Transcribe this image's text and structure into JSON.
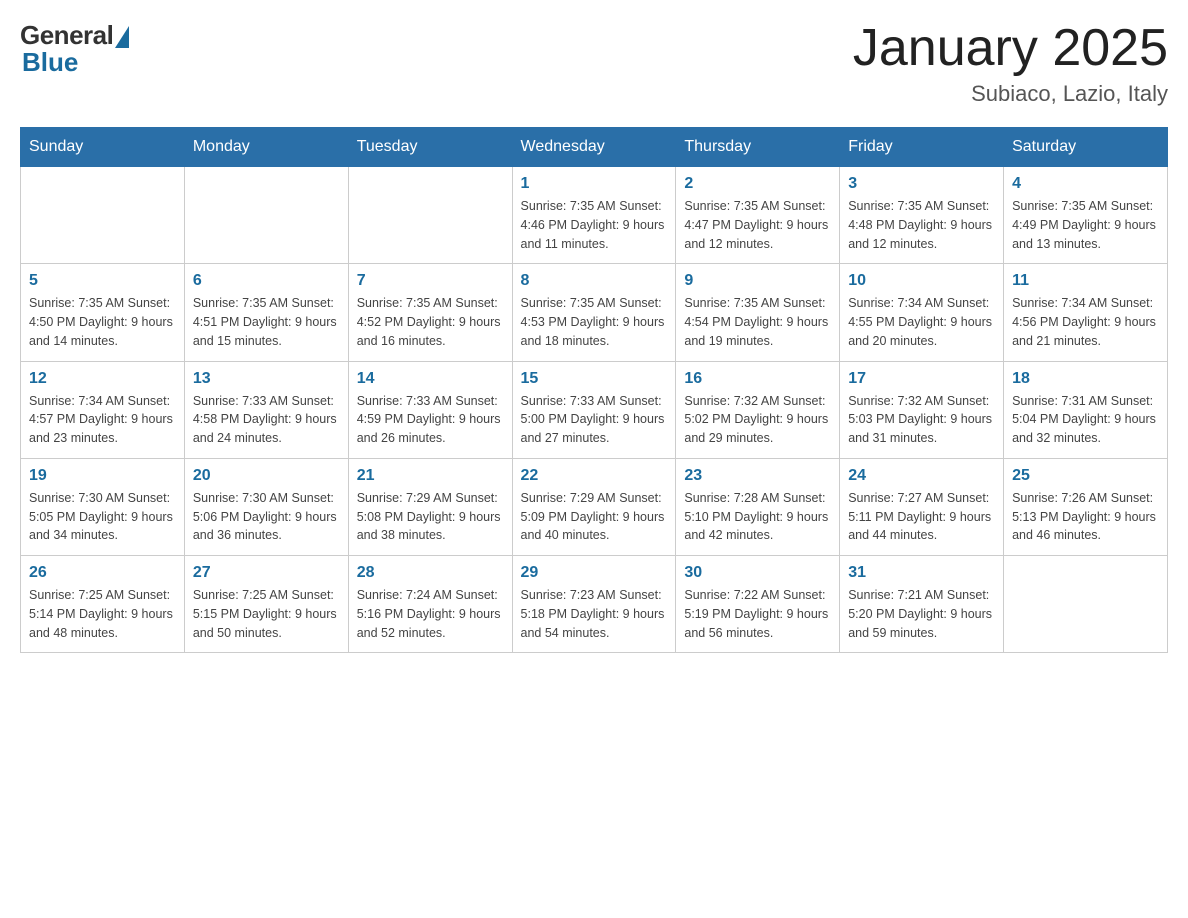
{
  "header": {
    "logo_general": "General",
    "logo_blue": "Blue",
    "title": "January 2025",
    "subtitle": "Subiaco, Lazio, Italy"
  },
  "days_of_week": [
    "Sunday",
    "Monday",
    "Tuesday",
    "Wednesday",
    "Thursday",
    "Friday",
    "Saturday"
  ],
  "weeks": [
    [
      {
        "day": "",
        "info": ""
      },
      {
        "day": "",
        "info": ""
      },
      {
        "day": "",
        "info": ""
      },
      {
        "day": "1",
        "info": "Sunrise: 7:35 AM\nSunset: 4:46 PM\nDaylight: 9 hours\nand 11 minutes."
      },
      {
        "day": "2",
        "info": "Sunrise: 7:35 AM\nSunset: 4:47 PM\nDaylight: 9 hours\nand 12 minutes."
      },
      {
        "day": "3",
        "info": "Sunrise: 7:35 AM\nSunset: 4:48 PM\nDaylight: 9 hours\nand 12 minutes."
      },
      {
        "day": "4",
        "info": "Sunrise: 7:35 AM\nSunset: 4:49 PM\nDaylight: 9 hours\nand 13 minutes."
      }
    ],
    [
      {
        "day": "5",
        "info": "Sunrise: 7:35 AM\nSunset: 4:50 PM\nDaylight: 9 hours\nand 14 minutes."
      },
      {
        "day": "6",
        "info": "Sunrise: 7:35 AM\nSunset: 4:51 PM\nDaylight: 9 hours\nand 15 minutes."
      },
      {
        "day": "7",
        "info": "Sunrise: 7:35 AM\nSunset: 4:52 PM\nDaylight: 9 hours\nand 16 minutes."
      },
      {
        "day": "8",
        "info": "Sunrise: 7:35 AM\nSunset: 4:53 PM\nDaylight: 9 hours\nand 18 minutes."
      },
      {
        "day": "9",
        "info": "Sunrise: 7:35 AM\nSunset: 4:54 PM\nDaylight: 9 hours\nand 19 minutes."
      },
      {
        "day": "10",
        "info": "Sunrise: 7:34 AM\nSunset: 4:55 PM\nDaylight: 9 hours\nand 20 minutes."
      },
      {
        "day": "11",
        "info": "Sunrise: 7:34 AM\nSunset: 4:56 PM\nDaylight: 9 hours\nand 21 minutes."
      }
    ],
    [
      {
        "day": "12",
        "info": "Sunrise: 7:34 AM\nSunset: 4:57 PM\nDaylight: 9 hours\nand 23 minutes."
      },
      {
        "day": "13",
        "info": "Sunrise: 7:33 AM\nSunset: 4:58 PM\nDaylight: 9 hours\nand 24 minutes."
      },
      {
        "day": "14",
        "info": "Sunrise: 7:33 AM\nSunset: 4:59 PM\nDaylight: 9 hours\nand 26 minutes."
      },
      {
        "day": "15",
        "info": "Sunrise: 7:33 AM\nSunset: 5:00 PM\nDaylight: 9 hours\nand 27 minutes."
      },
      {
        "day": "16",
        "info": "Sunrise: 7:32 AM\nSunset: 5:02 PM\nDaylight: 9 hours\nand 29 minutes."
      },
      {
        "day": "17",
        "info": "Sunrise: 7:32 AM\nSunset: 5:03 PM\nDaylight: 9 hours\nand 31 minutes."
      },
      {
        "day": "18",
        "info": "Sunrise: 7:31 AM\nSunset: 5:04 PM\nDaylight: 9 hours\nand 32 minutes."
      }
    ],
    [
      {
        "day": "19",
        "info": "Sunrise: 7:30 AM\nSunset: 5:05 PM\nDaylight: 9 hours\nand 34 minutes."
      },
      {
        "day": "20",
        "info": "Sunrise: 7:30 AM\nSunset: 5:06 PM\nDaylight: 9 hours\nand 36 minutes."
      },
      {
        "day": "21",
        "info": "Sunrise: 7:29 AM\nSunset: 5:08 PM\nDaylight: 9 hours\nand 38 minutes."
      },
      {
        "day": "22",
        "info": "Sunrise: 7:29 AM\nSunset: 5:09 PM\nDaylight: 9 hours\nand 40 minutes."
      },
      {
        "day": "23",
        "info": "Sunrise: 7:28 AM\nSunset: 5:10 PM\nDaylight: 9 hours\nand 42 minutes."
      },
      {
        "day": "24",
        "info": "Sunrise: 7:27 AM\nSunset: 5:11 PM\nDaylight: 9 hours\nand 44 minutes."
      },
      {
        "day": "25",
        "info": "Sunrise: 7:26 AM\nSunset: 5:13 PM\nDaylight: 9 hours\nand 46 minutes."
      }
    ],
    [
      {
        "day": "26",
        "info": "Sunrise: 7:25 AM\nSunset: 5:14 PM\nDaylight: 9 hours\nand 48 minutes."
      },
      {
        "day": "27",
        "info": "Sunrise: 7:25 AM\nSunset: 5:15 PM\nDaylight: 9 hours\nand 50 minutes."
      },
      {
        "day": "28",
        "info": "Sunrise: 7:24 AM\nSunset: 5:16 PM\nDaylight: 9 hours\nand 52 minutes."
      },
      {
        "day": "29",
        "info": "Sunrise: 7:23 AM\nSunset: 5:18 PM\nDaylight: 9 hours\nand 54 minutes."
      },
      {
        "day": "30",
        "info": "Sunrise: 7:22 AM\nSunset: 5:19 PM\nDaylight: 9 hours\nand 56 minutes."
      },
      {
        "day": "31",
        "info": "Sunrise: 7:21 AM\nSunset: 5:20 PM\nDaylight: 9 hours\nand 59 minutes."
      },
      {
        "day": "",
        "info": ""
      }
    ]
  ]
}
